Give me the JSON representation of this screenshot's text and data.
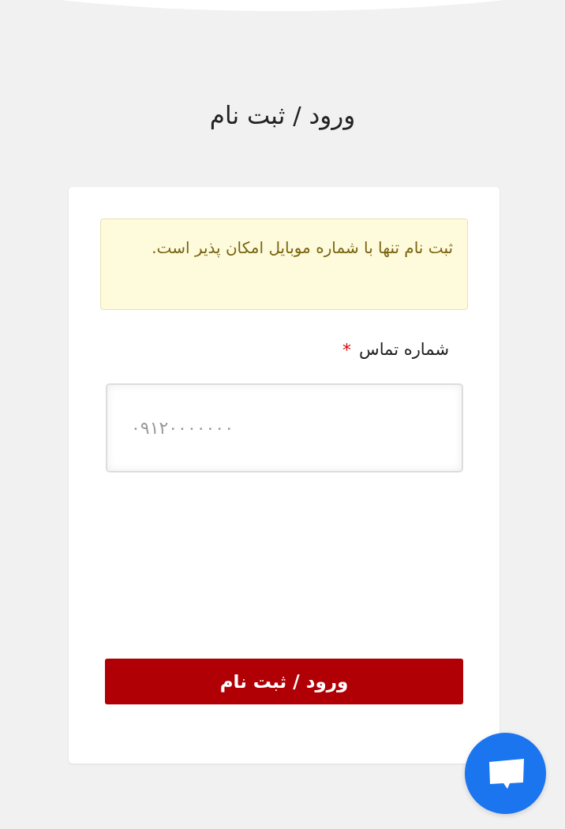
{
  "title": "ورود / ثبت نام",
  "alert": "ثبت نام تنها با شماره موبایل امکان پذیر است.",
  "phone_field": {
    "label": "شماره تماس",
    "required_mark": "*",
    "required": true,
    "placeholder": "۰۹۱۲۰۰۰۰۰۰۰"
  },
  "submit_button": "ورود / ثبت نام"
}
